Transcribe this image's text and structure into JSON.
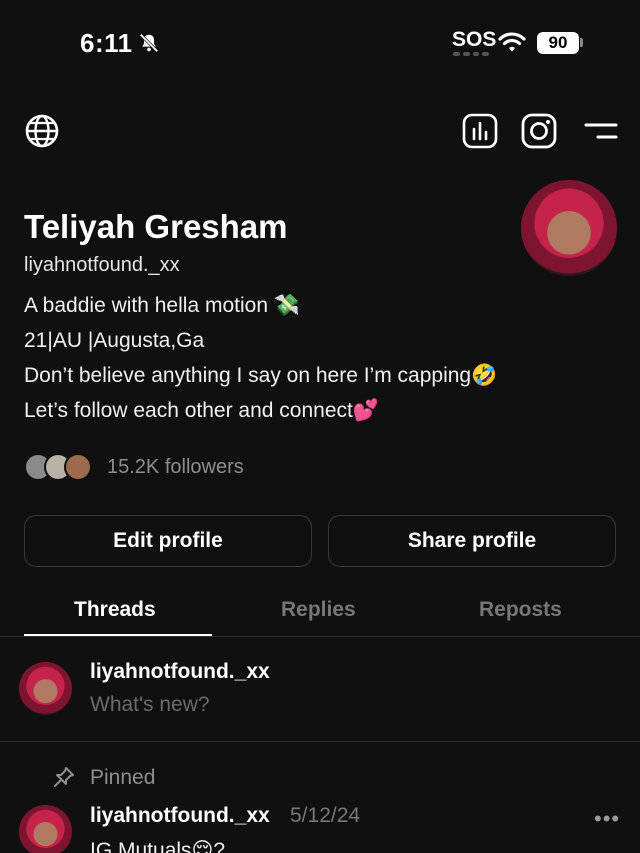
{
  "status_bar": {
    "time": "6:11",
    "carrier": "SOS",
    "battery": "90"
  },
  "nav": {
    "left_icon": "globe-icon",
    "right_icons": [
      "insights-icon",
      "instagram-icon",
      "menu-icon"
    ]
  },
  "profile": {
    "name": "Teliyah Gresham",
    "handle": "liyahnotfound._xx",
    "bio": [
      "A baddie with hella motion 💸",
      "21|AU |Augusta,Ga",
      "Don’t believe anything I say on here I’m capping🤣",
      "Let’s follow each other and connect💕"
    ],
    "followers": "15.2K followers"
  },
  "buttons": {
    "edit": "Edit profile",
    "share": "Share profile"
  },
  "tabs": {
    "items": [
      "Threads",
      "Replies",
      "Reposts"
    ],
    "active": "Threads"
  },
  "composer": {
    "username": "liyahnotfound._xx",
    "placeholder": "What's new?"
  },
  "pinned_post": {
    "label": "Pinned",
    "username": "liyahnotfound._xx",
    "date": "5/12/24",
    "more": "•••",
    "text": "IG Mutuals😌?"
  },
  "colors": {
    "background": "#101010",
    "text_primary": "#ffffff",
    "text_secondary": "#8e8e8e",
    "border": "#3a3a3a"
  }
}
